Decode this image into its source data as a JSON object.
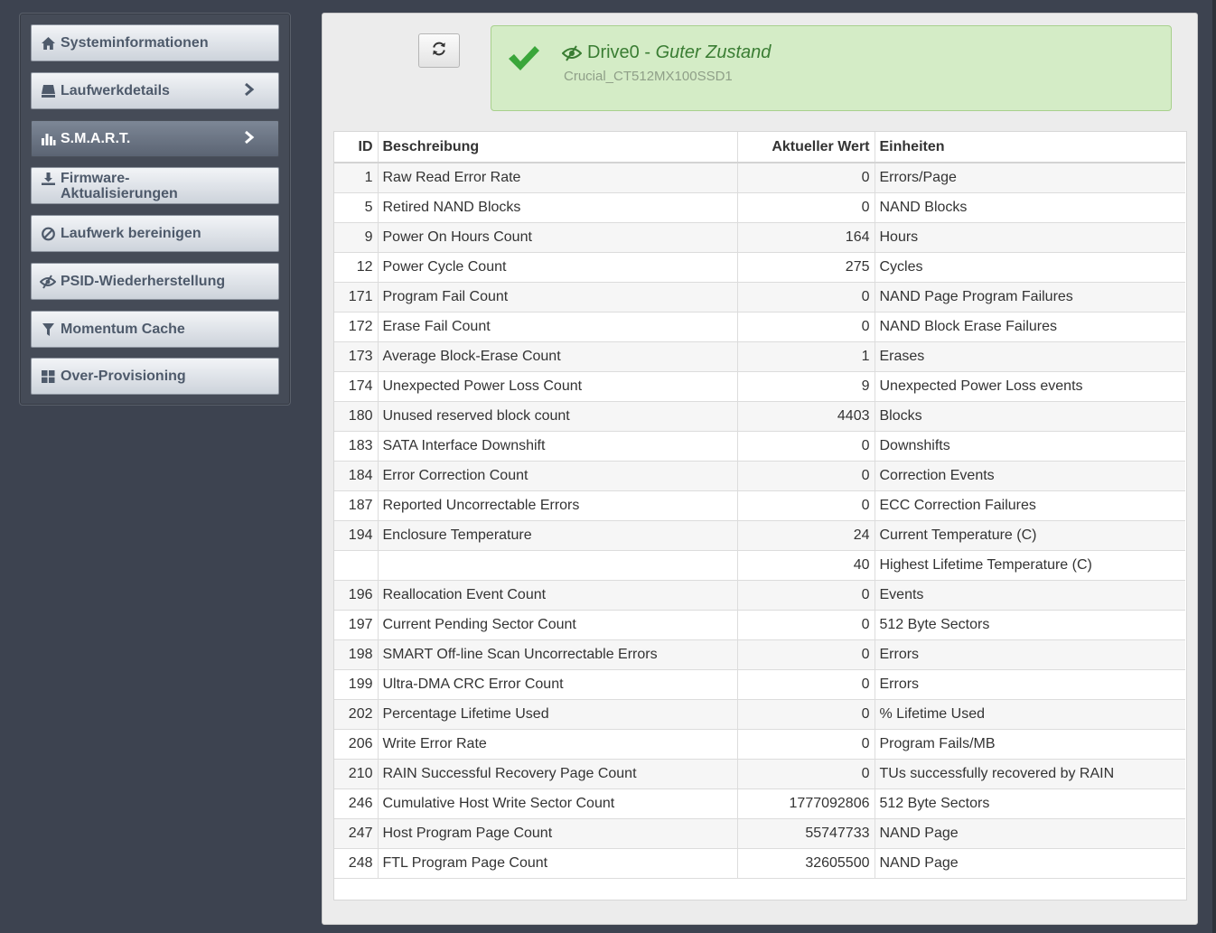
{
  "sidebar": {
    "items": [
      {
        "label": "Systeminformationen",
        "icon": "home-icon",
        "active": false,
        "chevron": false
      },
      {
        "label": "Laufwerkdetails",
        "icon": "drive-icon",
        "active": false,
        "chevron": true
      },
      {
        "label": "S.M.A.R.T.",
        "icon": "bar-chart-icon",
        "active": true,
        "chevron": true
      },
      {
        "label": "Firmware-Aktualisierungen",
        "label_line1": "Firmware-",
        "label_line2": "Aktualisierungen",
        "icon": "download-icon",
        "active": false,
        "chevron": false
      },
      {
        "label": "Laufwerk bereinigen",
        "icon": "ban-icon",
        "active": false,
        "chevron": false
      },
      {
        "label": "PSID-Wiederherstellung",
        "icon": "eye-slash-icon",
        "active": false,
        "chevron": false
      },
      {
        "label": "Momentum Cache",
        "icon": "filter-icon",
        "active": false,
        "chevron": false
      },
      {
        "label": "Over-Provisioning",
        "icon": "grid-icon",
        "active": false,
        "chevron": false
      }
    ]
  },
  "status": {
    "drive_name": "Drive0",
    "separator": " - ",
    "state": "Guter Zustand",
    "model": "Crucial_CT512MX100SSD1",
    "color": "#3a7d33"
  },
  "table": {
    "headers": {
      "id": "ID",
      "desc": "Beschreibung",
      "val": "Aktueller Wert",
      "unit": "Einheiten"
    },
    "rows": [
      {
        "id": "1",
        "desc": "Raw Read Error Rate",
        "val": "0",
        "unit": "Errors/Page"
      },
      {
        "id": "5",
        "desc": "Retired NAND Blocks",
        "val": "0",
        "unit": "NAND Blocks"
      },
      {
        "id": "9",
        "desc": "Power On Hours Count",
        "val": "164",
        "unit": "Hours"
      },
      {
        "id": "12",
        "desc": "Power Cycle Count",
        "val": "275",
        "unit": "Cycles"
      },
      {
        "id": "171",
        "desc": "Program Fail Count",
        "val": "0",
        "unit": "NAND Page Program Failures"
      },
      {
        "id": "172",
        "desc": "Erase Fail Count",
        "val": "0",
        "unit": "NAND Block Erase Failures"
      },
      {
        "id": "173",
        "desc": "Average Block-Erase Count",
        "val": "1",
        "unit": "Erases"
      },
      {
        "id": "174",
        "desc": "Unexpected Power Loss Count",
        "val": "9",
        "unit": "Unexpected Power Loss events"
      },
      {
        "id": "180",
        "desc": "Unused reserved block count",
        "val": "4403",
        "unit": "Blocks"
      },
      {
        "id": "183",
        "desc": "SATA Interface Downshift",
        "val": "0",
        "unit": "Downshifts"
      },
      {
        "id": "184",
        "desc": "Error Correction Count",
        "val": "0",
        "unit": "Correction Events"
      },
      {
        "id": "187",
        "desc": "Reported Uncorrectable Errors",
        "val": "0",
        "unit": "ECC Correction Failures"
      },
      {
        "id": "194",
        "desc": "Enclosure Temperature",
        "val": "24",
        "unit": "Current Temperature (C)"
      },
      {
        "id": "",
        "desc": "",
        "val": "40",
        "unit": "Highest Lifetime Temperature (C)"
      },
      {
        "id": "196",
        "desc": "Reallocation Event Count",
        "val": "0",
        "unit": "Events"
      },
      {
        "id": "197",
        "desc": "Current Pending Sector Count",
        "val": "0",
        "unit": "512 Byte Sectors"
      },
      {
        "id": "198",
        "desc": "SMART Off-line Scan Uncorrectable Errors",
        "val": "0",
        "unit": "Errors"
      },
      {
        "id": "199",
        "desc": "Ultra-DMA CRC Error Count",
        "val": "0",
        "unit": "Errors"
      },
      {
        "id": "202",
        "desc": "Percentage Lifetime Used",
        "val": "0",
        "unit": "% Lifetime Used"
      },
      {
        "id": "206",
        "desc": "Write Error Rate",
        "val": "0",
        "unit": "Program Fails/MB"
      },
      {
        "id": "210",
        "desc": "RAIN Successful Recovery Page Count",
        "val": "0",
        "unit": "TUs successfully recovered by RAIN"
      },
      {
        "id": "246",
        "desc": "Cumulative Host Write Sector Count",
        "val": "1777092806",
        "unit": "512 Byte Sectors"
      },
      {
        "id": "247",
        "desc": "Host Program Page Count",
        "val": "55747733",
        "unit": "NAND Page"
      },
      {
        "id": "248",
        "desc": "FTL Program Page Count",
        "val": "32605500",
        "unit": "NAND Page"
      }
    ]
  }
}
